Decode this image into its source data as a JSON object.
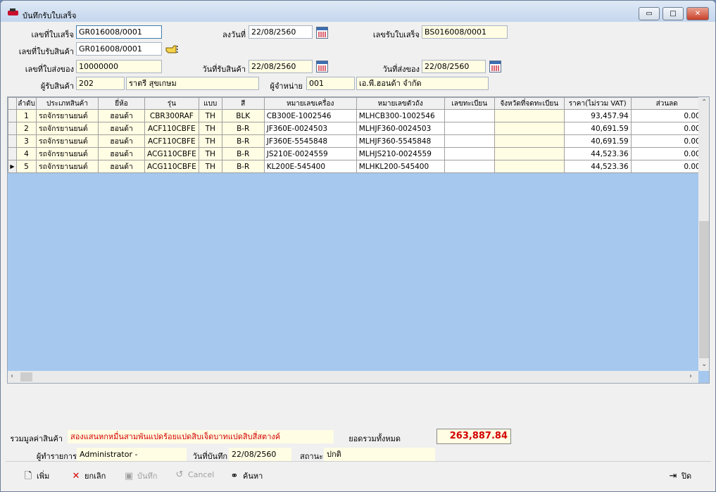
{
  "window": {
    "title": "บันทึกรับใบเสร็จ",
    "btn_min": "▭",
    "btn_max": "□",
    "btn_close": "✕"
  },
  "form": {
    "receipt_no_label": "เลขที่ใบเสร็จ",
    "receipt_no": "GR016008/0001",
    "date_label": "ลงวันที่",
    "date": "22/08/2560",
    "receipt_recv_label": "เลขรับใบเสร็จ",
    "receipt_recv": "BS016008/0001",
    "goods_recv_no_label": "เลขที่ใบรับสินค้า",
    "goods_recv_no": "GR016008/0001",
    "delivery_no_label": "เลขที่ใบส่งของ",
    "delivery_no": "10000000",
    "goods_recv_date_label": "วันที่รับสินค้า",
    "goods_recv_date": "22/08/2560",
    "delivery_date_label": "วันที่ส่งของ",
    "delivery_date": "22/08/2560",
    "receiver_label": "ผู้รับสินค้า",
    "receiver_code": "202",
    "receiver_name": "ราตรี สุขเกษม",
    "dealer_label": "ผู้จำหน่าย",
    "dealer_code": "001",
    "dealer_name": "เอ.พี.ฮอนด้า จำกัด"
  },
  "table": {
    "headers": [
      "ลำดับ",
      "ประเภทสินค้า",
      "ยี่ห้อ",
      "รุ่น",
      "แบบ",
      "สี",
      "หมายเลขเครื่อง",
      "หมายเลขตัวถัง",
      "เลขทะเบียน",
      "จังหวัดที่จดทะเบียน",
      "ราคา(ไม่รวม VAT)",
      "ส่วนลด"
    ],
    "rows": [
      {
        "no": "1",
        "type": "รถจักรยานยนต์",
        "brand": "ฮอนด้า",
        "model": "CBR300RAF",
        "style": "TH",
        "color": "BLK",
        "engine": "CB300E-1002546",
        "chassis": "MLHCB300-1002546",
        "plate": "",
        "province": "",
        "price": "93,457.94",
        "discount": "0.00"
      },
      {
        "no": "2",
        "type": "รถจักรยานยนต์",
        "brand": "ฮอนด้า",
        "model": "ACF110CBFE",
        "style": "TH",
        "color": "B-R",
        "engine": "JF360E-0024503",
        "chassis": "MLHJF360-0024503",
        "plate": "",
        "province": "",
        "price": "40,691.59",
        "discount": "0.00"
      },
      {
        "no": "3",
        "type": "รถจักรยานยนต์",
        "brand": "ฮอนด้า",
        "model": "ACF110CBFE",
        "style": "TH",
        "color": "B-R",
        "engine": "JF360E-5545848",
        "chassis": "MLHJF360-5545848",
        "plate": "",
        "province": "",
        "price": "40,691.59",
        "discount": "0.00"
      },
      {
        "no": "4",
        "type": "รถจักรยานยนต์",
        "brand": "ฮอนด้า",
        "model": "ACG110CBFE",
        "style": "TH",
        "color": "B-R",
        "engine": "JS210E-0024559",
        "chassis": "MLHJS210-0024559",
        "plate": "",
        "province": "",
        "price": "44,523.36",
        "discount": "0.00"
      },
      {
        "no": "5",
        "type": "รถจักรยานยนต์",
        "brand": "ฮอนด้า",
        "model": "ACG110CBFE",
        "style": "TH",
        "color": "B-R",
        "engine": "KL200E-545400",
        "chassis": "MLHKL200-545400",
        "plate": "",
        "province": "",
        "price": "44,523.36",
        "discount": "0.00"
      }
    ]
  },
  "summary": {
    "total_text_label": "รวมมูลค่าสินค้า",
    "total_text": "สองแสนหกหมื่นสามพันแปดร้อยแปดสิบเจ็ดบาทแปดสิบสี่สตางค์",
    "total_label": "ยอดรวมทั้งหมด",
    "total": "263,887.84",
    "operator_label": "ผู้ทำรายการ",
    "operator": "Administrator -",
    "save_date_label": "วันที่บันทึก",
    "save_date": "22/08/2560",
    "status_label": "สถานะ",
    "status": "ปกติ"
  },
  "toolbar": {
    "add": "เพิ่ม",
    "cancel_doc": "ยกเลิก",
    "save": "บันทึก",
    "cancel": "Cancel",
    "search": "ค้นหา",
    "close": "ปิด"
  },
  "colors": {
    "grid_bg": "#a6c8ee",
    "yellow_field": "#fffde3",
    "total_red": "#d40000"
  }
}
